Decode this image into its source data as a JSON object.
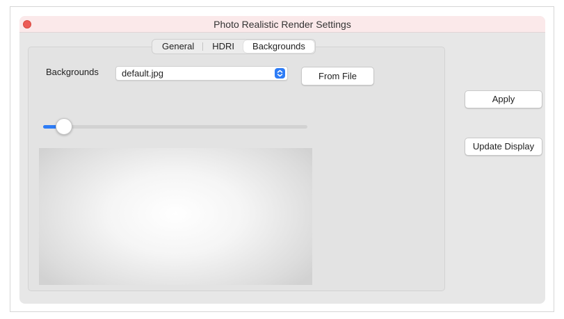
{
  "window": {
    "title": "Photo Realistic Render Settings"
  },
  "tabs": [
    {
      "label": "General",
      "active": false
    },
    {
      "label": "HDRI",
      "active": false
    },
    {
      "label": "Backgrounds",
      "active": true
    }
  ],
  "backgrounds": {
    "label": "Backgrounds",
    "selected": "default.jpg",
    "from_file_label": "From File",
    "slider_fraction": 0.08
  },
  "actions": {
    "apply_label": "Apply",
    "update_display_label": "Update Display"
  },
  "colors": {
    "accent": "#2d7cf6",
    "close": "#ec5b56",
    "titlebar": "#fbe9ea"
  },
  "icons": {
    "close": "close-button-dot",
    "select_arrow": "up-down-chevron-icon"
  }
}
